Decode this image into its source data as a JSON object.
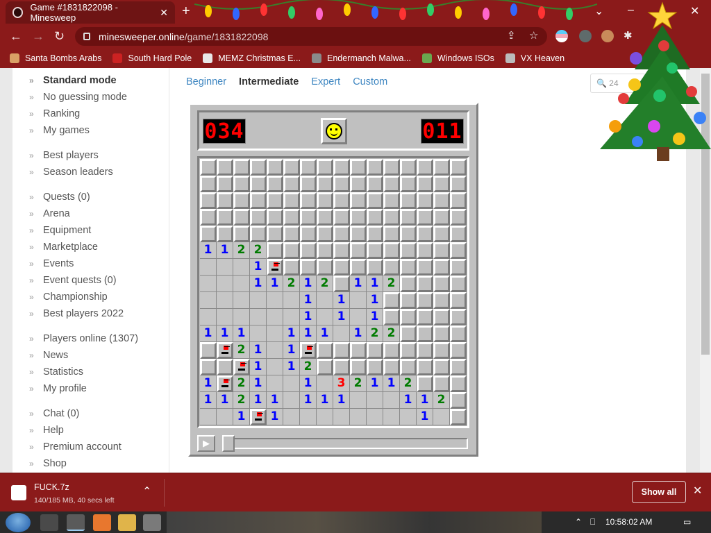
{
  "browser": {
    "tab_title": "Game #1831822098 - Minesweep",
    "tab_close": "✕",
    "new_tab": "+",
    "url_host": "minesweeper.online",
    "url_path": "/game/1831822098",
    "window_controls": {
      "minimize": "–",
      "maximize": "□",
      "close": "✕",
      "tab_search": "⌄"
    }
  },
  "bookmarks": [
    {
      "label": "Santa Bombs Arabs",
      "color": "#d9a066"
    },
    {
      "label": "South Hard Pole",
      "color": "#cc2222"
    },
    {
      "label": "MEMZ Christmas E...",
      "color": "#e8e8e8"
    },
    {
      "label": "Endermanch Malwa...",
      "color": "#8a8a8a"
    },
    {
      "label": "Windows ISOs",
      "color": "#6aa84f"
    },
    {
      "label": "VX Heaven",
      "color": "#bbbbbb"
    }
  ],
  "sidebar": {
    "items": [
      {
        "label": "Standard mode",
        "active": true
      },
      {
        "label": "No guessing mode"
      },
      {
        "label": "Ranking"
      },
      {
        "label": "My games"
      },
      {
        "label": "Best players"
      },
      {
        "label": "Season leaders"
      },
      {
        "label": "Quests (0)"
      },
      {
        "label": "Arena"
      },
      {
        "label": "Equipment"
      },
      {
        "label": "Marketplace"
      },
      {
        "label": "Events"
      },
      {
        "label": "Event quests (0)"
      },
      {
        "label": "Championship"
      },
      {
        "label": "Best players 2022"
      },
      {
        "label": "Players online (1307)"
      },
      {
        "label": "News"
      },
      {
        "label": "Statistics"
      },
      {
        "label": "My profile"
      },
      {
        "label": "Chat (0)"
      },
      {
        "label": "Help"
      },
      {
        "label": "Premium account"
      },
      {
        "label": "Shop"
      }
    ]
  },
  "levels": [
    {
      "label": "Beginner"
    },
    {
      "label": "Intermediate",
      "current": true
    },
    {
      "label": "Expert"
    },
    {
      "label": "Custom"
    }
  ],
  "search": {
    "value": "24"
  },
  "game": {
    "mines_left": "034",
    "timer": "011",
    "board": [
      "################",
      "################",
      "################",
      "################",
      "################",
      "1122############",
      "...1F###########",
      "...11212#112####",
      "......1.1.1#####",
      "......1.1.1#####",
      "111..111.122####",
      "#F21.1F#########",
      "##F1.12#########",
      "1F21..1.32112###",
      "11211.111...112#",
      "..1F1........1.#"
    ]
  },
  "download": {
    "file_name": "FUCK.7z",
    "progress_text": "140/185 MB, 40 secs left",
    "show_all": "Show all",
    "close": "✕",
    "caret": "⌃"
  },
  "taskbar": {
    "clock": "10:58:02 AM"
  }
}
